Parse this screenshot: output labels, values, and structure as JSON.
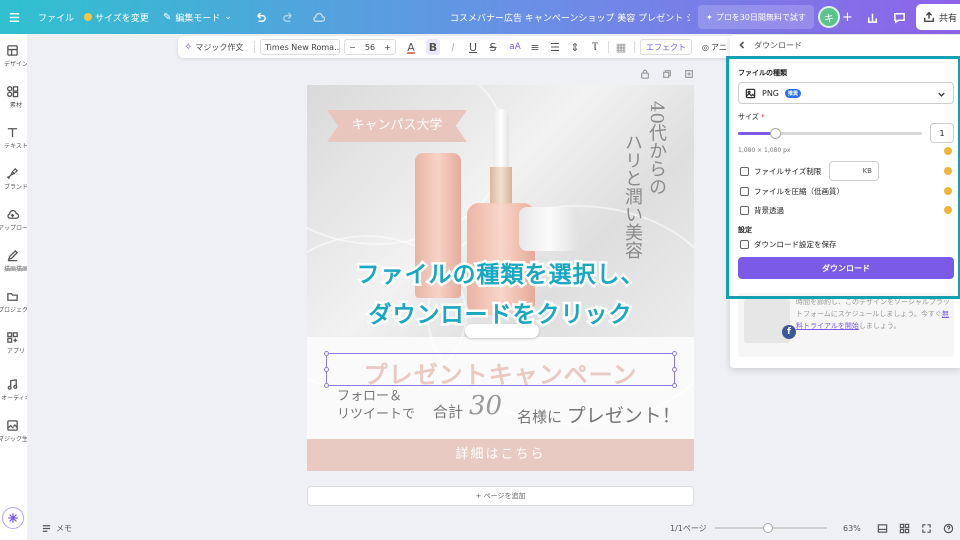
{
  "topbar": {
    "menu_icon": "hamburger-icon",
    "file_label": "ファイル",
    "resize_label": "サイズを変更",
    "edit_mode_label": "編集モード",
    "doc_title": "コスメバナー広告 キャンペーンショップ 美容 プレゼント シン...",
    "trial_label": "プロを30日間無料で試す",
    "avatar_initial": "キ",
    "share_label": "共有"
  },
  "sidebar": {
    "items": [
      {
        "label": "デザイン",
        "icon": "layout-icon"
      },
      {
        "label": "素材",
        "icon": "shapes-icon"
      },
      {
        "label": "テキスト",
        "icon": "text-icon"
      },
      {
        "label": "ブランド",
        "icon": "brand-icon"
      },
      {
        "label": "アップロード",
        "icon": "cloud-upload-icon"
      },
      {
        "label": "描画描画",
        "icon": "pen-icon"
      },
      {
        "label": "プロジェクト",
        "icon": "folder-icon"
      },
      {
        "label": "アプリ",
        "icon": "apps-icon"
      },
      {
        "label": "オーディオ",
        "icon": "music-icon"
      },
      {
        "label": "マジック生成",
        "icon": "image-magic-icon"
      }
    ]
  },
  "toolbar": {
    "magic_write": "マジック作文",
    "font_name": "Times New Roma...",
    "font_size": "56",
    "minus": "−",
    "plus": "+",
    "effect_label": "エフェクト",
    "animate_label": "アニ"
  },
  "design": {
    "tag_text": "キャンパス大学",
    "vertical_col1": "40代からの",
    "vertical_col2": "ハリと潤い美容",
    "cta_line1": "ファイルの種類を選択し、",
    "cta_line2": "ダウンロードをクリック",
    "present_title": "プレゼントキャンペーン",
    "follow_line1": "フォロー＆",
    "follow_line2": "リツイートで",
    "total_label": "合計",
    "big_number": "30",
    "name_suffix": "名様に",
    "present_label": "プレゼント！",
    "detail_button": "詳細はこちら"
  },
  "add_page_label": "+ ページを追加",
  "footer": {
    "notes_label": "メモ",
    "page_counter": "1/1ページ",
    "zoom_value": 0.63,
    "zoom_label": "63%"
  },
  "download_panel": {
    "title": "ダウンロード",
    "file_type_label": "ファイルの種類",
    "file_type_value": "PNG",
    "recommended_badge": "推奨",
    "size_label": "サイズ",
    "size_required_mark": "*",
    "size_value": "1",
    "size_fraction": 0.2,
    "dimensions_text": "1,080 × 1,080 px",
    "file_size_limit_label": "ファイルサイズ制限",
    "kb_unit": "KB",
    "compress_label": "ファイルを圧縮（低画質）",
    "transparent_label": "背景透過",
    "settings_label": "設定",
    "save_settings_label": "ダウンロード設定を保存",
    "download_button": "ダウンロード",
    "promo_text_before": "時間を節約し、このデザインをソーシャルプラットフォームにスケジュールしましょう。今すぐ",
    "promo_link": "無料トライアルを開始",
    "promo_text_after": "しましょう。",
    "promo_fb_letter": "f",
    "accent_color": "#7c5ae8",
    "highlight_color": "#12a0b2"
  }
}
